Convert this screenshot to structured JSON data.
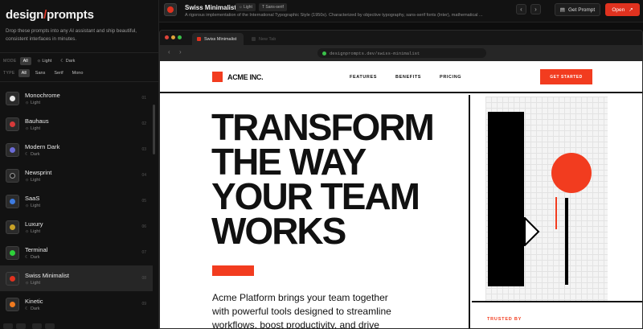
{
  "sidebar": {
    "logo_left": "design",
    "logo_slash": "/",
    "logo_right": "prompts",
    "tagline": "Drop these prompts into any AI assistant and ship beautiful, consistent interfaces in minutes.",
    "mode_label": "MODE",
    "mode_options": [
      "All",
      "Light",
      "Dark"
    ],
    "type_label": "TYPE",
    "type_options": [
      "All",
      "Sans",
      "Serif",
      "Mono"
    ],
    "items": [
      {
        "name": "Monochrome",
        "mode": "Light",
        "num": "01",
        "color": "#e8e8e8"
      },
      {
        "name": "Bauhaus",
        "mode": "Light",
        "num": "02",
        "color": "#d63a3a"
      },
      {
        "name": "Modern Dark",
        "mode": "Dark",
        "num": "03",
        "color": "#6b6bd6"
      },
      {
        "name": "Newsprint",
        "mode": "Light",
        "num": "04",
        "color": "#1a1a1a"
      },
      {
        "name": "SaaS",
        "mode": "Light",
        "num": "05",
        "color": "#3d7be0"
      },
      {
        "name": "Luxury",
        "mode": "Light",
        "num": "06",
        "color": "#c9a227"
      },
      {
        "name": "Terminal",
        "mode": "Dark",
        "num": "07",
        "color": "#2ed13a"
      },
      {
        "name": "Swiss Minimalist",
        "mode": "Light",
        "num": "08",
        "color": "#e0321f"
      },
      {
        "name": "Kinetic",
        "mode": "Dark",
        "num": "09",
        "color": "#f07a1f"
      }
    ]
  },
  "topbar": {
    "title": "Swiss Minimalist",
    "badge_mode": "Light",
    "badge_type": "Sans-serif",
    "description": "A rigorous implementation of the International Typographic Style (1950s). Characterized by objective typography, sans-serif fonts (Inter), mathematical ...",
    "get_prompt": "Get Prompt",
    "open": "Open"
  },
  "browser": {
    "tab_active": "Swiss Minimalist",
    "tab_inactive": "New Tab",
    "url": "designprompts.dev/swiss-minimalist"
  },
  "site": {
    "brand": "ACME INC.",
    "nav": [
      "FEATURES",
      "BENEFITS",
      "PRICING"
    ],
    "cta": "GET STARTED",
    "headline": [
      "TRANSFORM",
      "THE WAY",
      "YOUR TEAM",
      "WORKS"
    ],
    "lead": "Acme Platform brings your team together with powerful tools designed to streamline workflows, boost productivity, and drive",
    "trusted": "TRUSTED BY"
  },
  "colors": {
    "accent": "#e0321f",
    "site_accent": "#f23c1f",
    "bg": "#0d0d0d"
  }
}
